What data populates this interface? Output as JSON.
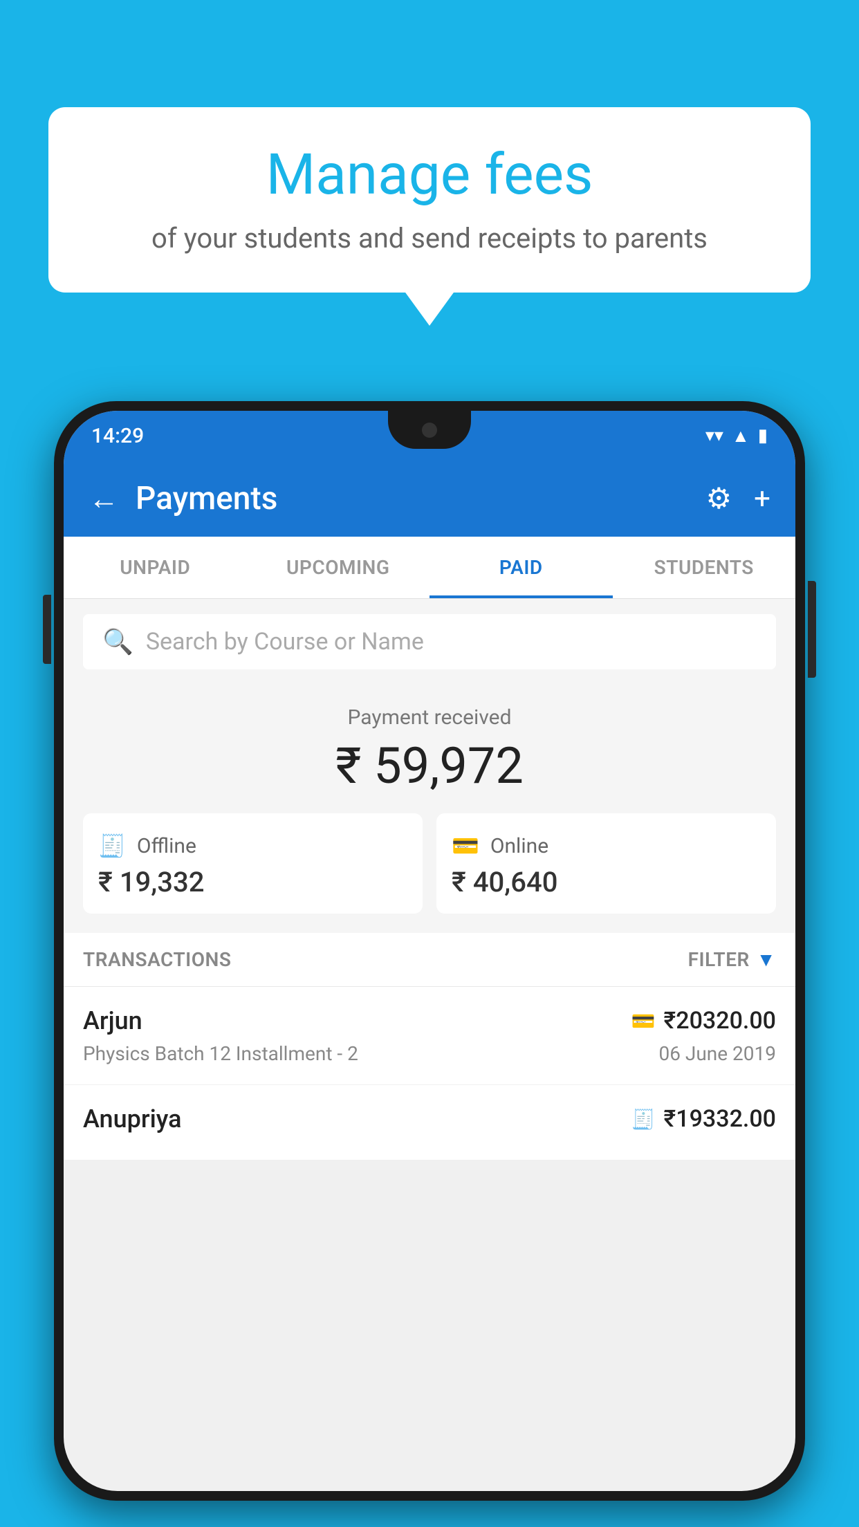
{
  "background_color": "#1ab4e8",
  "bubble": {
    "title": "Manage fees",
    "subtitle": "of your students and send receipts to parents"
  },
  "status_bar": {
    "time": "14:29",
    "wifi_icon": "▼",
    "signal_icon": "▲",
    "battery_icon": "▮"
  },
  "app_bar": {
    "title": "Payments",
    "back_icon": "←",
    "settings_icon": "⚙",
    "add_icon": "+"
  },
  "tabs": [
    {
      "label": "UNPAID",
      "active": false
    },
    {
      "label": "UPCOMING",
      "active": false
    },
    {
      "label": "PAID",
      "active": true
    },
    {
      "label": "STUDENTS",
      "active": false
    }
  ],
  "search": {
    "placeholder": "Search by Course or Name"
  },
  "payment_summary": {
    "label": "Payment received",
    "total_amount": "₹ 59,972",
    "offline": {
      "label": "Offline",
      "amount": "₹ 19,332"
    },
    "online": {
      "label": "Online",
      "amount": "₹ 40,640"
    }
  },
  "transactions": {
    "header_label": "TRANSACTIONS",
    "filter_label": "FILTER",
    "items": [
      {
        "name": "Arjun",
        "amount": "₹20320.00",
        "course": "Physics Batch 12 Installment - 2",
        "date": "06 June 2019",
        "payment_type": "online"
      },
      {
        "name": "Anupriya",
        "amount": "₹19332.00",
        "course": "",
        "date": "",
        "payment_type": "offline"
      }
    ]
  }
}
